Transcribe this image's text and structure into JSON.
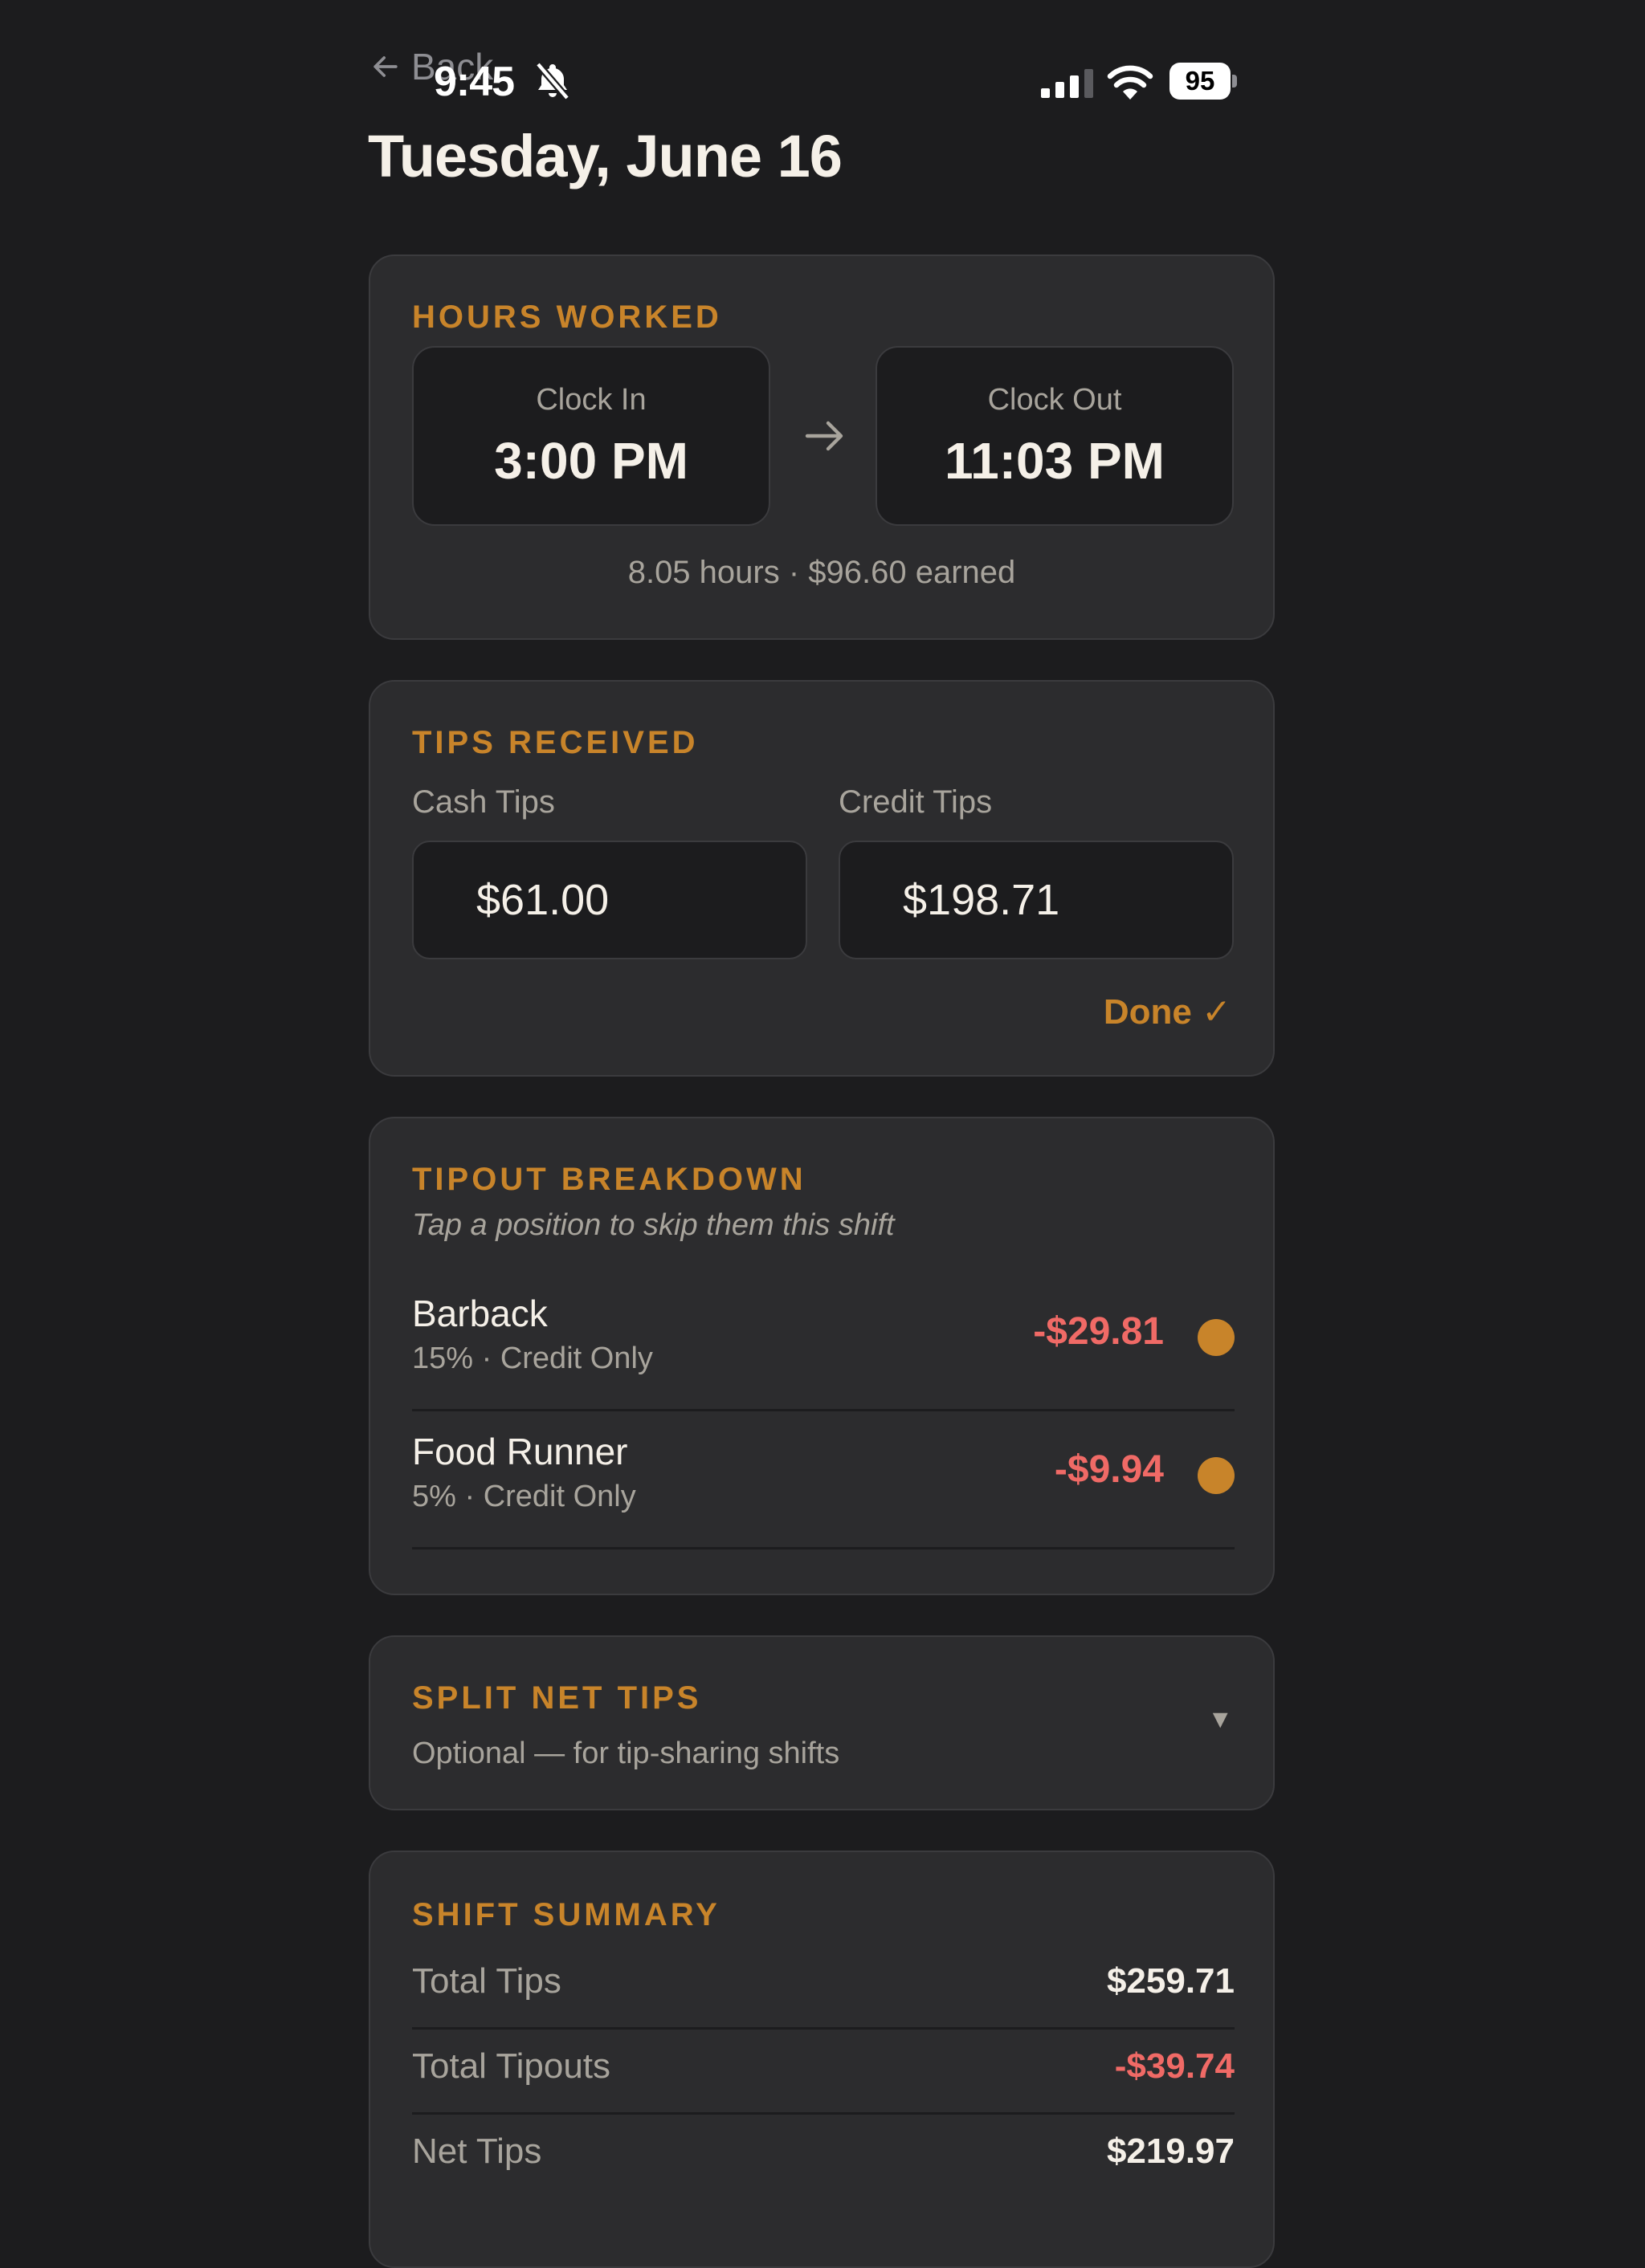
{
  "status_bar": {
    "time": "9:45",
    "battery": "95"
  },
  "nav": {
    "back_label": "Back"
  },
  "page": {
    "title": "Tuesday, June 16"
  },
  "hours": {
    "section_label": "HOURS WORKED",
    "clock_in_label": "Clock In",
    "clock_in_value": "3:00 PM",
    "clock_out_label": "Clock Out",
    "clock_out_value": "11:03 PM",
    "summary": "8.05 hours · $96.60 earned"
  },
  "tips": {
    "section_label": "TIPS RECEIVED",
    "cash_label": "Cash Tips",
    "cash_value": "$61.00",
    "credit_label": "Credit Tips",
    "credit_value": "$198.71",
    "done_label": "Done ✓"
  },
  "tipout": {
    "section_label": "TIPOUT BREAKDOWN",
    "hint": "Tap a position to skip them this shift",
    "rows": [
      {
        "name": "Barback",
        "meta": "15% · Credit Only",
        "amount": "-$29.81"
      },
      {
        "name": "Food Runner",
        "meta": "5% · Credit Only",
        "amount": "-$9.94"
      }
    ]
  },
  "split": {
    "section_label": "SPLIT NET TIPS",
    "subtitle": "Optional — for tip-sharing shifts",
    "chevron": "▼"
  },
  "summary": {
    "section_label": "SHIFT SUMMARY",
    "rows": [
      {
        "label": "Total Tips",
        "value": "$259.71"
      },
      {
        "label": "Total Tipouts",
        "value": "-$39.74"
      },
      {
        "label": "Net Tips",
        "value": "$219.97"
      }
    ]
  },
  "colors": {
    "accent": "#c8842a",
    "negative": "#f06a66",
    "background": "#1c1c1e",
    "card": "#2c2c2e"
  }
}
